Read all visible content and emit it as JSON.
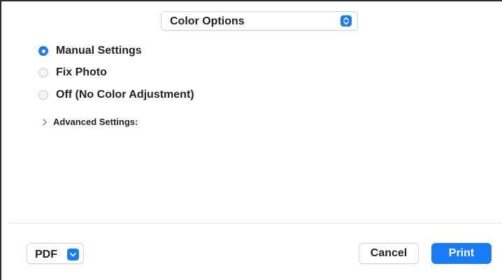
{
  "popup": {
    "label": "Color Options",
    "icon": "up-down-stepper-icon"
  },
  "color_mode": {
    "options": [
      {
        "label": "Manual Settings",
        "checked": true
      },
      {
        "label": "Fix Photo",
        "checked": false
      },
      {
        "label": "Off (No Color Adjustment)",
        "checked": false
      }
    ]
  },
  "advanced": {
    "label": "Advanced Settings:",
    "icon": "chevron-right-icon",
    "expanded": false
  },
  "footer": {
    "pdf_label": "PDF",
    "pdf_icon": "chevron-down-icon",
    "cancel_label": "Cancel",
    "print_label": "Print"
  },
  "colors": {
    "accent": "#1a7cf5",
    "border": "#d4d4d6",
    "separator": "#e2e2e4",
    "text": "#222222"
  }
}
